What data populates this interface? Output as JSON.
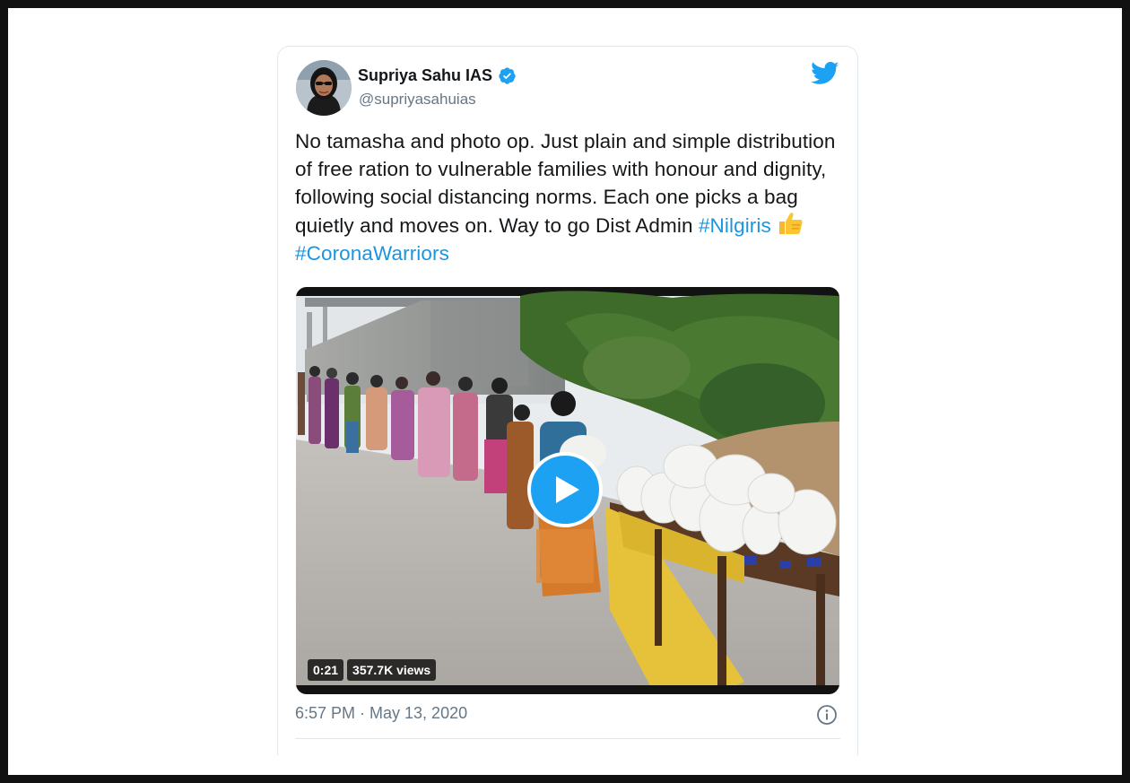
{
  "tweet": {
    "author": {
      "name": "Supriya Sahu IAS",
      "handle": "@supriyasahuias",
      "verified_icon": "verified-badge-icon",
      "avatar_icon": "profile-avatar"
    },
    "text_plain": "No tamasha and photo op. Just plain and simple distribution of free ration to vulnerable families with honour and dignity, following social distancing norms. Each one picks a bag quietly and moves on. Way to go Dist Admin",
    "hashtag_1": "#Nilgiris",
    "emoji": "thumbs-up-emoji",
    "hashtag_2": "#CoronaWarriors",
    "video": {
      "duration": "0:21",
      "views": "357.7K views",
      "play_icon": "play-icon"
    },
    "timestamp": "6:57 PM · May 13, 2020",
    "info_icon": "info-icon",
    "brand_icon": "twitter-bird-icon"
  },
  "colors": {
    "hashtag": "#1b95e0",
    "play_button": "#1da1f2",
    "verified": "#1da1f2",
    "twitter_bird": "#1da1f2",
    "meta_text": "#657786",
    "body_text": "#14171a"
  }
}
